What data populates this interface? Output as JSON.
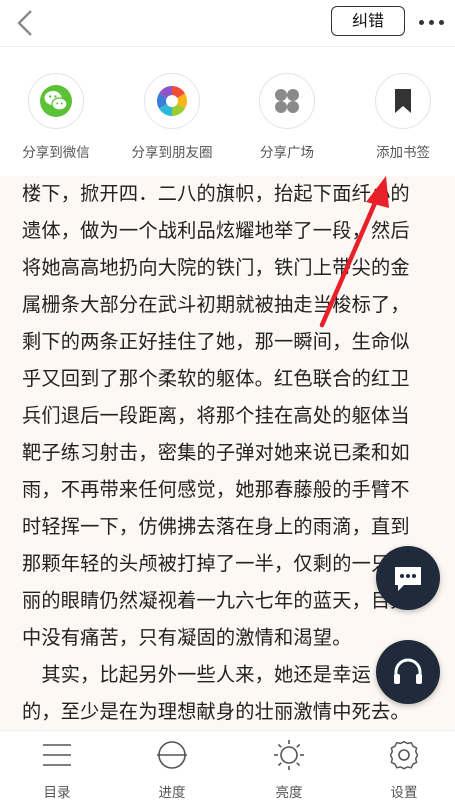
{
  "topbar": {
    "report_label": "纠错"
  },
  "share": [
    {
      "label": "分享到微信",
      "icon": "wechat-icon"
    },
    {
      "label": "分享到朋友圈",
      "icon": "moments-icon"
    },
    {
      "label": "分享广场",
      "icon": "square-icon"
    },
    {
      "label": "添加书签",
      "icon": "bookmark-icon"
    }
  ],
  "reader": {
    "lines": [
      "楼下，掀开四．二八的旗帜，抬起下面纤小的",
      "遗体，做为一个战利品炫耀地举了一段，然后",
      "将她高高地扔向大院的铁门，铁门上带尖的金",
      "属栅条大部分在武斗初期就被抽走当梭标了，",
      "剩下的两条正好挂住了她，那一瞬间，生命似",
      "乎又回到了那个柔软的躯体。红色联合的红卫",
      "兵们退后一段距离，将那个挂在高处的躯体当",
      "靶子练习射击，密集的子弹对她来说已柔和如",
      "雨，不再带来任何感觉，她那春藤般的手臂不",
      "时轻挥一下，仿佛拂去落在身上的雨滴，直到",
      "那颗年轻的头颅被打掉了一半，仅剩的一只美",
      "丽的眼睛仍然凝视着一九六七年的蓝天，目光",
      "中没有痛苦，只有凝固的激情和渴望。",
      "　其实，比起另外一些人来，她还是幸运",
      "的，至少是在为理想献身的壮丽激情中死去。"
    ]
  },
  "bottom_nav": [
    {
      "label": "目录",
      "icon": "catalog-icon"
    },
    {
      "label": "进度",
      "icon": "progress-icon"
    },
    {
      "label": "亮度",
      "icon": "brightness-icon"
    },
    {
      "label": "设置",
      "icon": "settings-icon"
    }
  ],
  "colors": {
    "accent_arrow": "#e8202a",
    "fab_bg": "#1f2a3a",
    "wechat_green": "#5bc236"
  }
}
